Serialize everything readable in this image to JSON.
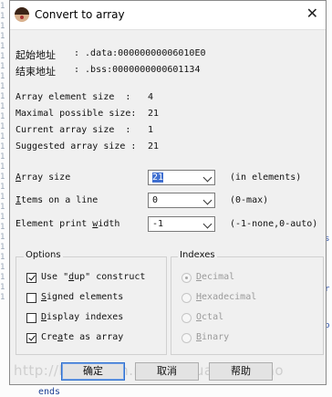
{
  "background": {
    "left_gutter": "111111111111111111111111111111",
    "right_marks": [
      "s",
      "r",
      "b"
    ],
    "bottom_text": "ends"
  },
  "dialog": {
    "title": "Convert to array",
    "close_glyph": "✕",
    "start_addr_label": "起始地址",
    "start_addr_value": ": .data:00000000006010E0",
    "end_addr_label": "结束地址",
    "end_addr_value": ": .bss:0000000000601134",
    "info": [
      {
        "label": "Array element size  :",
        "value": "4"
      },
      {
        "label": "Maximal possible size:",
        "value": "21"
      },
      {
        "label": "Current array size  :",
        "value": "1"
      },
      {
        "label": "Suggested array size :",
        "value": "21"
      }
    ],
    "array_size": {
      "label": "Array size",
      "value": "21",
      "hint": "(in elements)"
    },
    "items_on_line": {
      "label": "Items on a line",
      "value": "0",
      "hint": "(0-max)"
    },
    "element_print_width": {
      "label": "Element print width",
      "value": "-1",
      "hint": "(-1-none,0-auto)"
    },
    "options": {
      "legend": "Options",
      "items": [
        {
          "label": "Use \"dup\" construct",
          "checked": true
        },
        {
          "label": "Signed elements",
          "checked": false
        },
        {
          "label": "Display indexes",
          "checked": false
        },
        {
          "label": "Create as array",
          "checked": true
        }
      ]
    },
    "indexes": {
      "legend": "Indexes",
      "items": [
        {
          "label": "Decimal",
          "selected": true
        },
        {
          "label": "Hexadecimal",
          "selected": false
        },
        {
          "label": "Octal",
          "selected": false
        },
        {
          "label": "Binary",
          "selected": false
        }
      ]
    },
    "buttons": {
      "ok": "确定",
      "cancel": "取消",
      "help": "帮助"
    },
    "watermark": "http://blog.csdn.net/enryuanhenzhao"
  }
}
